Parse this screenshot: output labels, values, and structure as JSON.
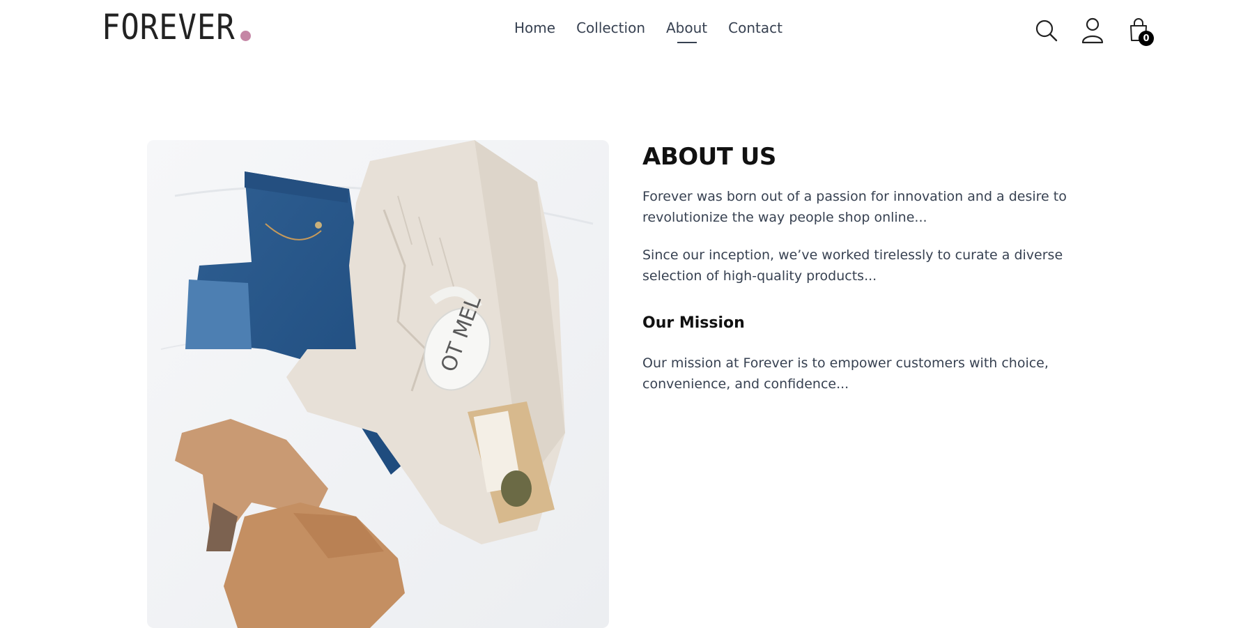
{
  "brand": {
    "name": "FOREVER",
    "dot_color": "#c586a5"
  },
  "nav": {
    "links": [
      {
        "label": "Home"
      },
      {
        "label": "Collection"
      },
      {
        "label": "About"
      },
      {
        "label": "Contact"
      }
    ],
    "active": "About"
  },
  "header_icons": {
    "search": "search-icon",
    "profile": "profile-icon",
    "cart": "cart-icon"
  },
  "cart": {
    "count": "0"
  },
  "about": {
    "title": "ABOUT US",
    "paragraph1": "Forever was born out of a passion for innovation and a desire to revolutionize the way people shop online...",
    "paragraph2": "Since our inception, we’ve worked tirelessly to curate a diverse selection of high-quality products...",
    "mission_title": "Our Mission",
    "mission_text": "Our mission at Forever is to empower customers with choice, convenience, and confidence...",
    "image_subject": "flat lay of jeans, knit cardigan, mug, tea pouch and suede ankle boots"
  }
}
